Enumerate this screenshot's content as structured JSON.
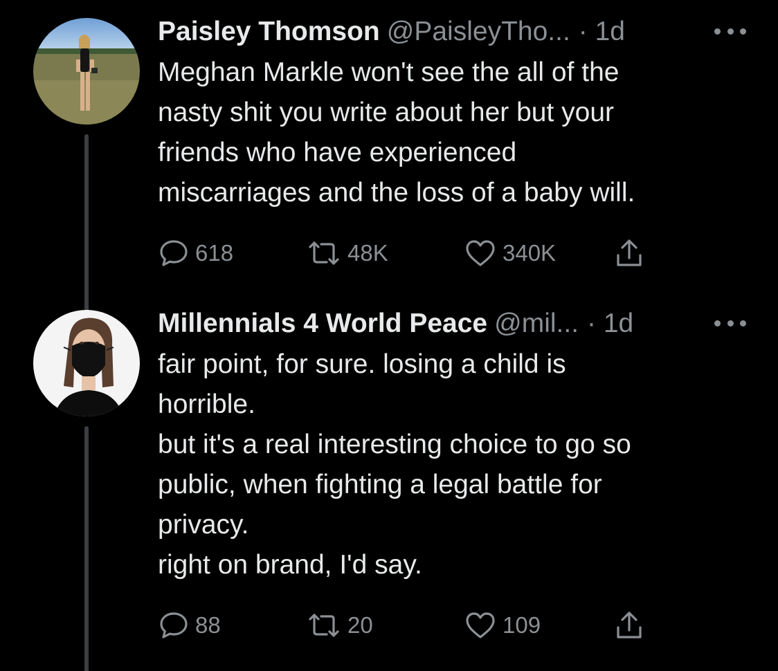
{
  "tweets": [
    {
      "name": "Paisley Thomson",
      "handle": "@PaisleyTho...",
      "time": "· 1d",
      "lines": [
        "Meghan Markle won't see the all of the",
        "nasty shit you write about her but your",
        "friends who have experienced",
        "miscarriages and the loss of a baby will."
      ],
      "replies": "618",
      "retweets": "48K",
      "likes": "340K"
    },
    {
      "name": "Millennials 4 World Peace",
      "handle": "@mil...",
      "time": "· 1d",
      "lines": [
        "fair point, for sure. losing a child is",
        "horrible.",
        "but it's a real interesting choice to go so",
        "public, when fighting a legal battle for",
        "privacy.",
        "right on brand, I'd say."
      ],
      "replies": "88",
      "retweets": "20",
      "likes": "109"
    }
  ],
  "icons": {
    "reply": "reply-icon",
    "retweet": "retweet-icon",
    "like": "heart-icon",
    "share": "share-icon",
    "more": "more-icon"
  },
  "colors": {
    "background": "#000000",
    "text": "#e7e9ea",
    "secondary": "#8b9095",
    "thread_line": "#3a3d41"
  }
}
